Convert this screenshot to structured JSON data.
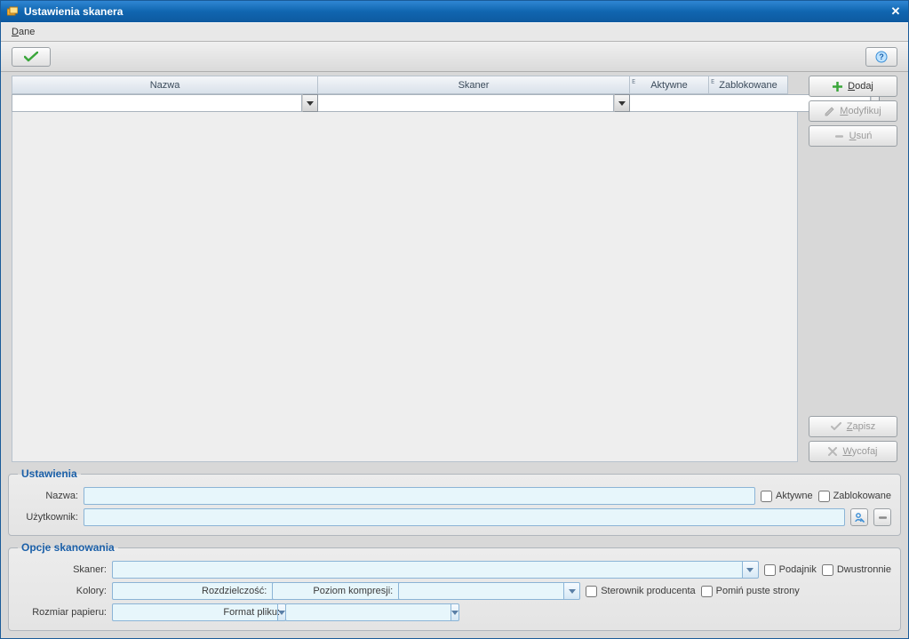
{
  "title": "Ustawienia skanera",
  "menu": {
    "dane": "Dane"
  },
  "toolbar": {
    "confirm": "OK",
    "help": "Pomoc"
  },
  "grid": {
    "cols": {
      "nazwa": "Nazwa",
      "skaner": "Skaner",
      "aktywne": "Aktywne",
      "zablokowane": "Zablokowane"
    }
  },
  "side": {
    "dodaj": "Dodaj",
    "modyfikuj": "Modyfikuj",
    "usun": "Usuń",
    "zapisz": "Zapisz",
    "wycofaj": "Wycofaj"
  },
  "grp_ustawienia": {
    "legend": "Ustawienia",
    "nazwa_lbl": "Nazwa:",
    "uzytkownik_lbl": "Użytkownik:",
    "aktywne_lbl": "Aktywne",
    "zablokowane_lbl": "Zablokowane"
  },
  "grp_opcje": {
    "legend": "Opcje skanowania",
    "skaner_lbl": "Skaner:",
    "podajnik_lbl": "Podajnik",
    "dwustronnie_lbl": "Dwustronnie",
    "kolory_lbl": "Kolory:",
    "rozdz_lbl": "Rozdzielczość:",
    "poziom_lbl": "Poziom kompresji:",
    "sterownik_lbl": "Sterownik producenta",
    "pomin_lbl": "Pomiń puste strony",
    "rozmiar_lbl": "Rozmiar papieru:",
    "format_lbl": "Format pliku:"
  }
}
